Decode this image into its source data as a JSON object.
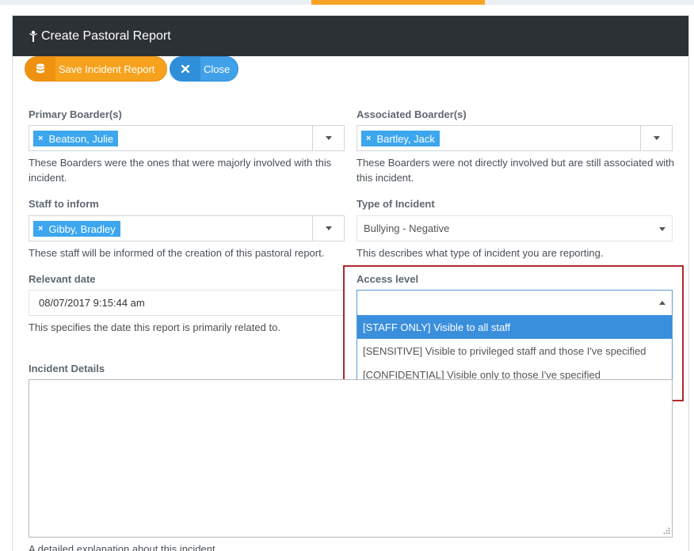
{
  "header": {
    "title": "Create Pastoral Report",
    "icon": "person-icon"
  },
  "toolbar": {
    "save_label": "Save Incident Report",
    "save_icon": "database-icon",
    "close_label": "Close",
    "close_icon": "close-icon"
  },
  "form": {
    "primary_boarders": {
      "label": "Primary Boarder(s)",
      "tags": [
        "Beatson, Julie"
      ],
      "help": "These Boarders were the ones that were majorly involved with this incident."
    },
    "associated_boarders": {
      "label": "Associated Boarder(s)",
      "tags": [
        "Bartley, Jack"
      ],
      "help": "These Boarders were not directly involved but are still associated with this incident."
    },
    "staff_to_inform": {
      "label": "Staff to inform",
      "tags": [
        "Gibby, Bradley"
      ],
      "help": "These staff will be informed of the creation of this pastoral report."
    },
    "incident_type": {
      "label": "Type of Incident",
      "value": "Bullying - Negative",
      "help": "This describes what type of incident you are reporting."
    },
    "relevant_date": {
      "label": "Relevant date",
      "value": "08/07/2017 9:15:44 am",
      "help": "This specifies the date this report is primarily related to."
    },
    "access_level": {
      "label": "Access level",
      "value": "",
      "options": [
        "[STAFF ONLY] Visible to all staff",
        "[SENSITIVE] Visible to privileged staff and those I've specified",
        "[CONFIDENTIAL] Visible only to those I've specified"
      ],
      "highlighted_index": 0
    },
    "incident_details": {
      "label": "Incident Details",
      "value": "",
      "help": "A detailed explanation about this incident."
    }
  },
  "colors": {
    "header_bg": "#2c3136",
    "save_button": "#f7a21d",
    "close_button": "#41a1e8",
    "tag_bg": "#3ca6ee",
    "option_highlight": "#3a8fdd",
    "annotation_border": "#b0282e"
  }
}
